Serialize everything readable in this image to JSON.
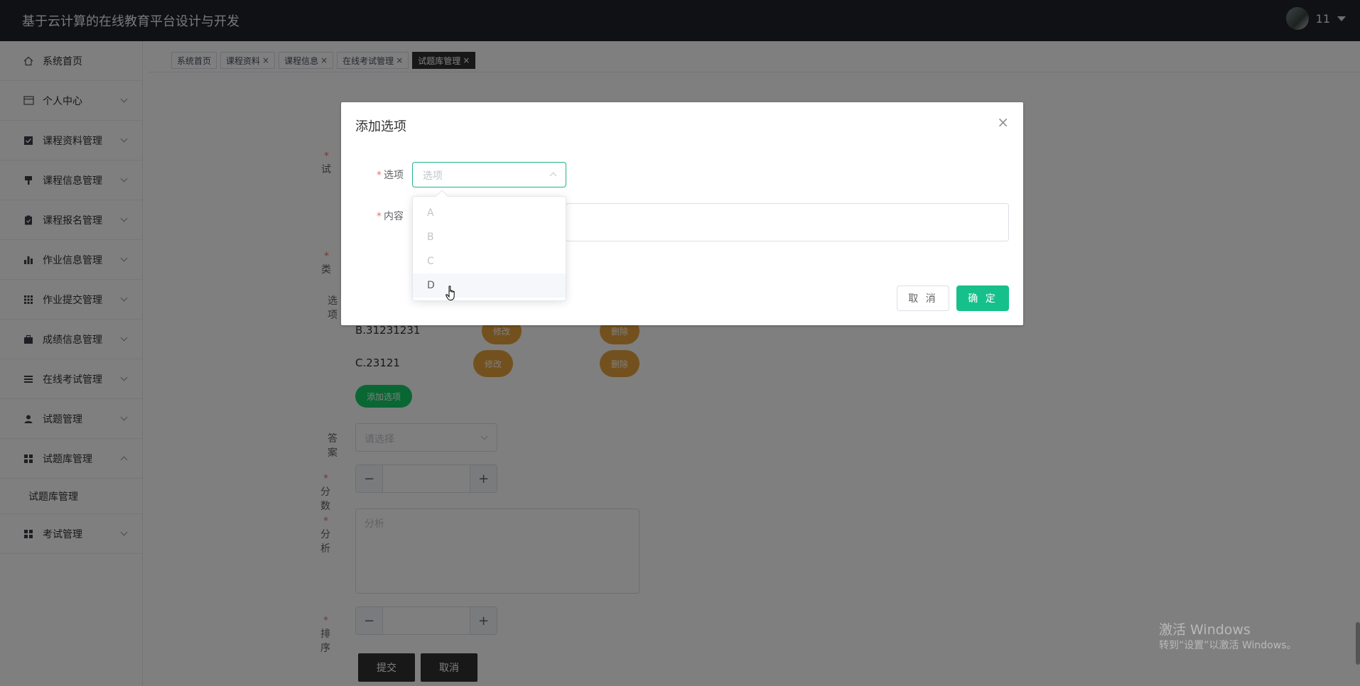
{
  "header": {
    "app_title": "基于云计算的在线教育平台设计与开发",
    "username": "11"
  },
  "sidebar": {
    "items": [
      {
        "label": "系统首页",
        "icon": "home-icon"
      },
      {
        "label": "个人中心",
        "icon": "card-icon"
      },
      {
        "label": "课程资料管理",
        "icon": "check-square-icon"
      },
      {
        "label": "课程信息管理",
        "icon": "brush-icon"
      },
      {
        "label": "课程报名管理",
        "icon": "clipboard-icon"
      },
      {
        "label": "作业信息管理",
        "icon": "bar-chart-icon"
      },
      {
        "label": "作业提交管理",
        "icon": "grid-icon"
      },
      {
        "label": "成绩信息管理",
        "icon": "briefcase-icon"
      },
      {
        "label": "在线考试管理",
        "icon": "list-icon"
      },
      {
        "label": "试题管理",
        "icon": "user-icon"
      },
      {
        "label": "试题库管理",
        "icon": "apps-icon"
      },
      {
        "label": "考试管理",
        "icon": "apps-icon"
      }
    ],
    "submenu_item": "试题库管理"
  },
  "tabs": [
    {
      "label": "系统首页",
      "closable": false
    },
    {
      "label": "课程资料",
      "closable": true
    },
    {
      "label": "课程信息",
      "closable": true
    },
    {
      "label": "在线考试管理",
      "closable": true
    },
    {
      "label": "试题库管理",
      "closable": true,
      "active": true
    }
  ],
  "bg_form": {
    "label_partial_1": "试",
    "label_partial_2": "类",
    "label_options": "选项",
    "option_b": "B.31231231",
    "option_c": "C.23121",
    "edit_label": "修改",
    "delete_label": "删除",
    "add_option_label": "添加选项",
    "answer_label": "答案",
    "answer_placeholder": "请选择",
    "score_label": "分数",
    "analysis_label": "分析",
    "analysis_placeholder": "分析",
    "sort_label": "排序",
    "submit_label": "提交",
    "cancel_label": "取消"
  },
  "dialog": {
    "title": "添加选项",
    "option_label": "选项",
    "option_placeholder": "选项",
    "content_label": "内容",
    "cancel_label": "取 消",
    "confirm_label": "确 定",
    "dropdown_options": [
      "A",
      "B",
      "C",
      "D"
    ],
    "hovered_option": "D"
  },
  "watermark": {
    "line1": "激活 Windows",
    "line2": "转到“设置”以激活 Windows。"
  },
  "colors": {
    "header_bg": "#1e2228",
    "primary_green": "#16c08a",
    "warning_orange": "#e6a23c",
    "required_red": "#f56c6c"
  }
}
